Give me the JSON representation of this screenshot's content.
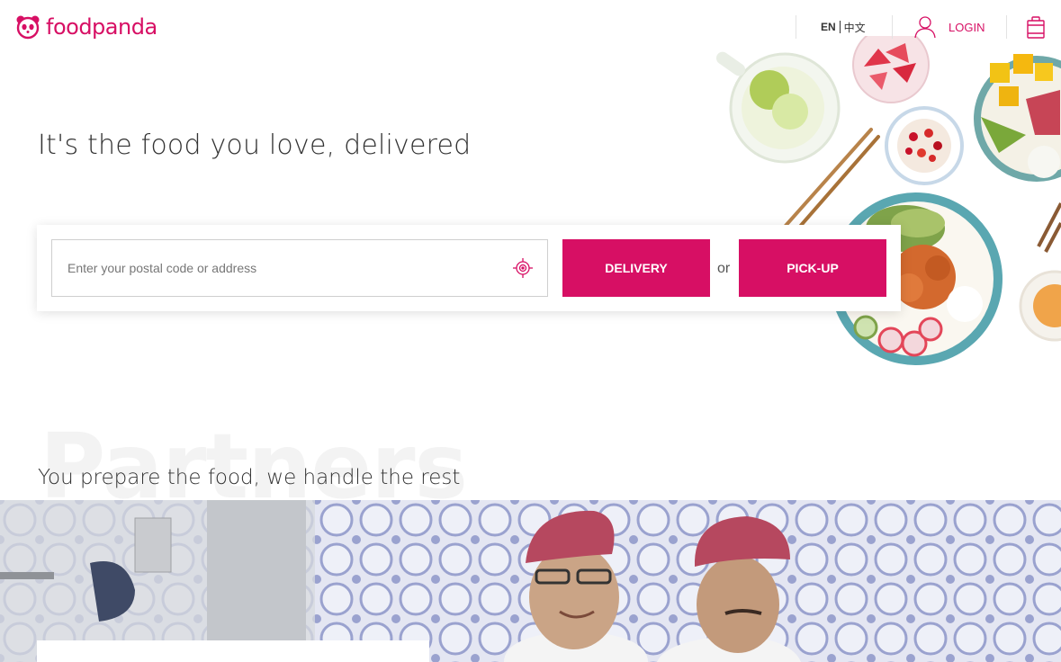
{
  "brand": {
    "name": "foodpanda",
    "color": "#d70f64",
    "logo_icon": "panda-icon"
  },
  "header": {
    "languages": [
      {
        "label": "EN",
        "active": true
      },
      {
        "label": "中文",
        "active": false
      }
    ],
    "login_label": "LOGIN",
    "user_icon": "user-icon",
    "cart_icon": "shopping-bag-icon"
  },
  "hero": {
    "title": "It's the food you love, delivered",
    "search": {
      "placeholder": "Enter your postal code or address",
      "value": "",
      "locate_icon": "locate-target-icon"
    },
    "delivery_label": "DELIVERY",
    "or_label": "or",
    "pickup_label": "PICK-UP"
  },
  "partners": {
    "watermark": "Partners",
    "subtitle": "You prepare the food, we handle the rest"
  }
}
